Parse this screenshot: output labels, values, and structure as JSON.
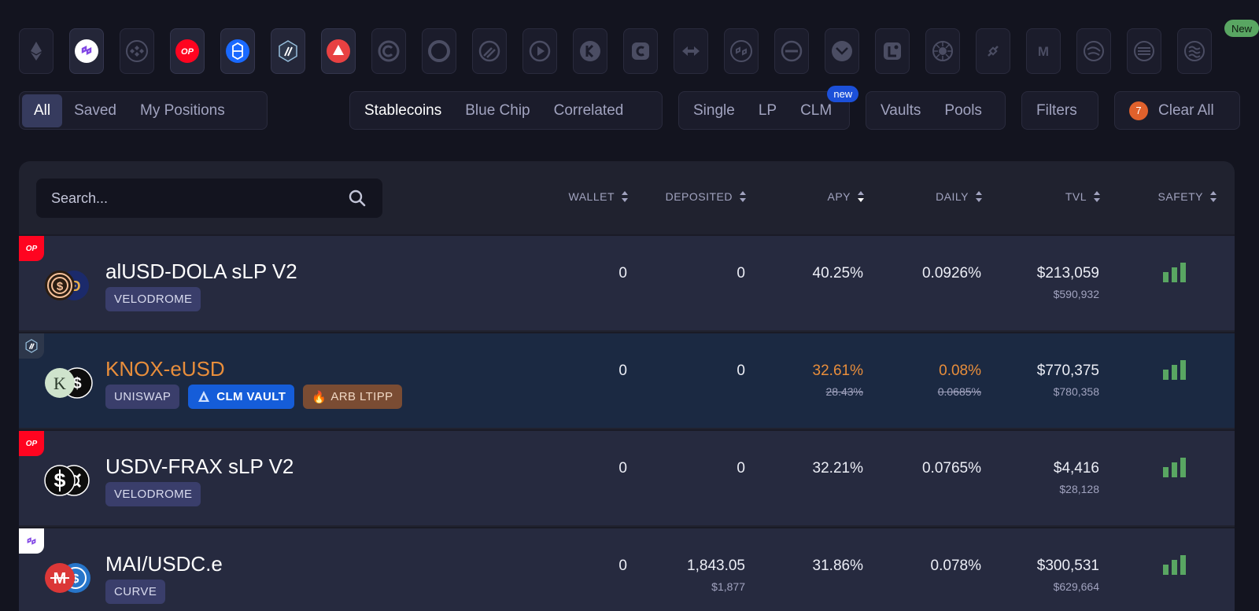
{
  "chain_icons": [
    {
      "name": "ethereum-icon",
      "selected": false
    },
    {
      "name": "polygon-icon",
      "selected": true,
      "color": "#8247e5"
    },
    {
      "name": "bnb-icon",
      "selected": false
    },
    {
      "name": "optimism-icon",
      "selected": true,
      "color": "#ff0420",
      "text": "OP"
    },
    {
      "name": "fantom-icon",
      "selected": true,
      "color": "#1969ff"
    },
    {
      "name": "arbitrum-icon",
      "selected": true,
      "color": "#2d374b"
    },
    {
      "name": "avalanche-icon",
      "selected": true,
      "color": "#e84142"
    },
    {
      "name": "celo-icon",
      "selected": false
    },
    {
      "name": "moonbeam-icon",
      "selected": false
    },
    {
      "name": "canto-icon",
      "selected": false
    },
    {
      "name": "kava-icon",
      "selected": false
    },
    {
      "name": "kava-k-icon",
      "selected": false
    },
    {
      "name": "cronos-icon",
      "selected": false
    },
    {
      "name": "zksync-icon",
      "selected": false
    },
    {
      "name": "polygon-zkevm-icon",
      "selected": false
    },
    {
      "name": "base-icon",
      "selected": false
    },
    {
      "name": "gnosis-icon",
      "selected": false
    },
    {
      "name": "linea-icon",
      "selected": false
    },
    {
      "name": "aurora-icon",
      "selected": false
    },
    {
      "name": "chainlink-icon",
      "selected": false
    },
    {
      "name": "mantle-icon",
      "selected": false
    },
    {
      "name": "fraxtal-icon",
      "selected": false
    },
    {
      "name": "scroll-icon",
      "selected": false
    },
    {
      "name": "sei-icon",
      "selected": false
    }
  ],
  "new_badge": "New",
  "filters": {
    "ownership": [
      "All",
      "Saved",
      "My Positions"
    ],
    "category": [
      "Stablecoins",
      "Blue Chip",
      "Correlated"
    ],
    "strategy": [
      "Single",
      "LP",
      "CLM"
    ],
    "strategy_badge": "new",
    "vault_type": [
      "Vaults",
      "Pools"
    ],
    "filters_label": "Filters",
    "clear_count": "7",
    "clear_label": "Clear All"
  },
  "search": {
    "placeholder": "Search..."
  },
  "columns": [
    "WALLET",
    "DEPOSITED",
    "APY",
    "DAILY",
    "TVL",
    "SAFETY"
  ],
  "rows": [
    {
      "chain": "optimism",
      "chain_label": "OP",
      "name": "alUSD-DOLA sLP V2",
      "tags": [
        {
          "label": "VELODROME",
          "style": "plain"
        }
      ],
      "wallet": "0",
      "deposited": "0",
      "deposited_usd": "",
      "apy": "40.25%",
      "apy_old": "",
      "daily": "0.0926%",
      "daily_old": "",
      "tvl": "$213,059",
      "tvl_sub": "$590,932",
      "safety_bars": 3,
      "highlight": false
    },
    {
      "chain": "arbitrum",
      "chain_label": "",
      "name": "KNOX-eUSD",
      "tags": [
        {
          "label": "UNISWAP",
          "style": "plain"
        },
        {
          "label": "CLM VAULT",
          "style": "blue",
          "icon": "clm-vault-icon"
        },
        {
          "label": "ARB LTIPP",
          "style": "brown",
          "icon": "flame-icon",
          "emoji": "🔥"
        }
      ],
      "wallet": "0",
      "deposited": "0",
      "deposited_usd": "",
      "apy": "32.61%",
      "apy_old": "28.43%",
      "daily": "0.08%",
      "daily_old": "0.0685%",
      "tvl": "$770,375",
      "tvl_sub": "$780,358",
      "safety_bars": 3,
      "highlight": true
    },
    {
      "chain": "optimism",
      "chain_label": "OP",
      "name": "USDV-FRAX sLP V2",
      "tags": [
        {
          "label": "VELODROME",
          "style": "plain"
        }
      ],
      "wallet": "0",
      "deposited": "0",
      "deposited_usd": "",
      "apy": "32.21%",
      "apy_old": "",
      "daily": "0.0765%",
      "daily_old": "",
      "tvl": "$4,416",
      "tvl_sub": "$28,128",
      "safety_bars": 3,
      "highlight": false
    },
    {
      "chain": "polygon",
      "chain_label": "",
      "name": "MAI/USDC.e",
      "tags": [
        {
          "label": "CURVE",
          "style": "plain"
        }
      ],
      "wallet": "0",
      "deposited": "1,843.05",
      "deposited_usd": "$1,877",
      "apy": "31.86%",
      "apy_old": "",
      "daily": "0.078%",
      "daily_old": "",
      "tvl": "$300,531",
      "tvl_sub": "$629,664",
      "safety_bars": 3,
      "highlight": false
    }
  ],
  "colors": {
    "accent_orange": "#e98e3b",
    "safety_green": "#59a662",
    "clm_blue": "#155dd9"
  }
}
